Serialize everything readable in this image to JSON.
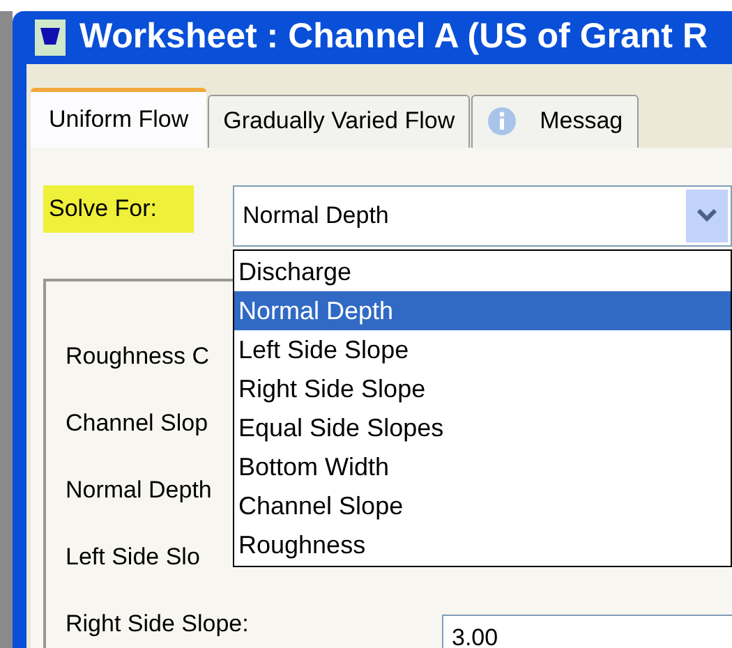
{
  "window": {
    "title": "Worksheet : Channel A (US of Grant R"
  },
  "tabs": [
    {
      "label": "Uniform Flow",
      "selected": true,
      "kind": "plain"
    },
    {
      "label": "Gradually Varied Flow",
      "selected": false,
      "kind": "plain"
    },
    {
      "label": "Messag",
      "selected": false,
      "kind": "info"
    }
  ],
  "solve_for": {
    "label": "Solve For:",
    "value": "Normal Depth",
    "expanded": true,
    "options": [
      {
        "label": "Discharge",
        "selected": false
      },
      {
        "label": "Normal Depth",
        "selected": true
      },
      {
        "label": "Left Side Slope",
        "selected": false
      },
      {
        "label": "Right Side Slope",
        "selected": false
      },
      {
        "label": "Equal Side Slopes",
        "selected": false
      },
      {
        "label": "Bottom Width",
        "selected": false
      },
      {
        "label": "Channel Slope",
        "selected": false
      },
      {
        "label": "Roughness",
        "selected": false
      }
    ]
  },
  "fields": [
    {
      "label": "Roughness C"
    },
    {
      "label": "Channel Slop"
    },
    {
      "label": "Normal Depth"
    },
    {
      "label": "Left Side Slo"
    },
    {
      "label": "Right Side Slope:",
      "value": "3.00"
    }
  ]
}
